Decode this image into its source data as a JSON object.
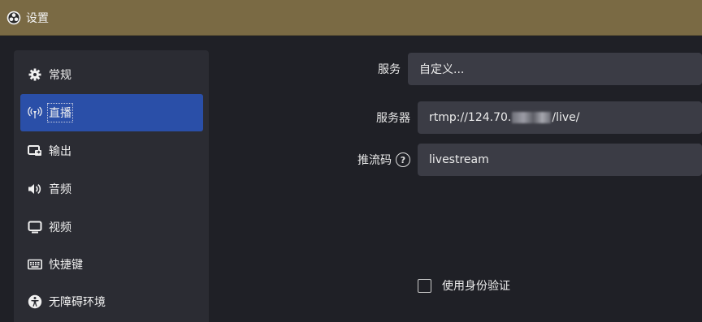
{
  "window": {
    "title": "设置",
    "app_icon": "obs-logo-icon"
  },
  "sidebar": {
    "items": [
      {
        "label": "常规",
        "icon": "gear-icon",
        "active": false
      },
      {
        "label": "直播",
        "icon": "antenna-icon",
        "active": true
      },
      {
        "label": "输出",
        "icon": "output-icon",
        "active": false
      },
      {
        "label": "音频",
        "icon": "speaker-icon",
        "active": false
      },
      {
        "label": "视频",
        "icon": "monitor-icon",
        "active": false
      },
      {
        "label": "快捷键",
        "icon": "keyboard-icon",
        "active": false
      },
      {
        "label": "无障碍环境",
        "icon": "accessibility-icon",
        "active": false
      }
    ]
  },
  "stream": {
    "service_label": "服务",
    "service_value": "自定义...",
    "server_label": "服务器",
    "server_prefix": "rtmp://124.70.",
    "server_suffix": "/live/",
    "key_label": "推流码",
    "key_help_icon": "help-icon",
    "key_value": "livestream",
    "auth_label": "使用身份验证",
    "auth_checked": false
  },
  "colors": {
    "titlebar": "#7a6a44",
    "background": "#1f2026",
    "sidebar": "#2b2c33",
    "active_item": "#2a4fa8",
    "field": "#3b3c45"
  }
}
